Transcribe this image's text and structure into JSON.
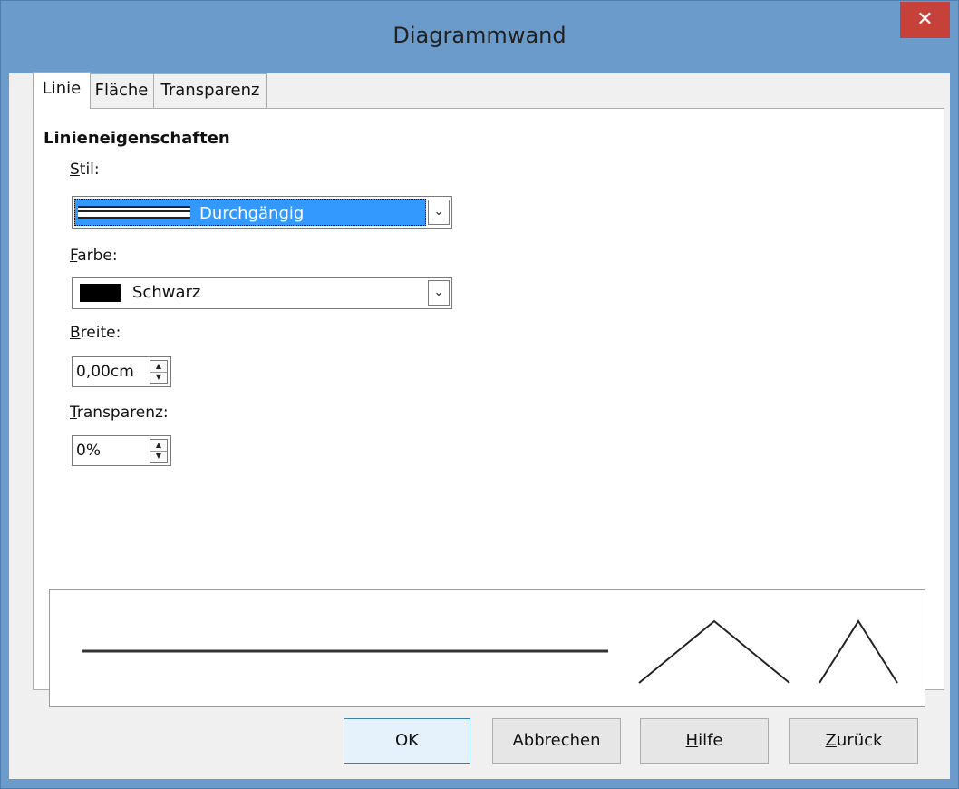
{
  "window": {
    "title": "Diagrammwand",
    "close_glyph": "✕",
    "close_icon": "close-icon"
  },
  "tabs": [
    {
      "label": "Linie",
      "active": true
    },
    {
      "label": "Fläche",
      "active": false
    },
    {
      "label": "Transparenz",
      "active": false
    }
  ],
  "line_properties": {
    "heading": "Linieneigenschaften",
    "style": {
      "label_accel": "S",
      "label_rest": "til:",
      "value": "Durchgängig",
      "selection_color": "#3399ff"
    },
    "color": {
      "label_accel": "F",
      "label_rest": "arbe:",
      "value": "Schwarz",
      "swatch": "#000000"
    },
    "width": {
      "label_accel": "B",
      "label_rest": "reite:",
      "value": "0,00cm"
    },
    "transparency": {
      "label_accel": "T",
      "label_rest": "ransparenz:",
      "value": "0%"
    }
  },
  "dropdown_arrow_glyph": "⌄",
  "spin_glyphs": {
    "up": "▲",
    "down": "▼"
  },
  "buttons": {
    "ok": "OK",
    "cancel": "Abbrechen",
    "help": {
      "accel": "H",
      "rest": "ilfe"
    },
    "reset": {
      "accel": "Z",
      "rest": "urück"
    }
  },
  "colors": {
    "titlebar": "#6a9bcb",
    "close": "#c7413b",
    "dialog_bg": "#f0f0f0"
  }
}
